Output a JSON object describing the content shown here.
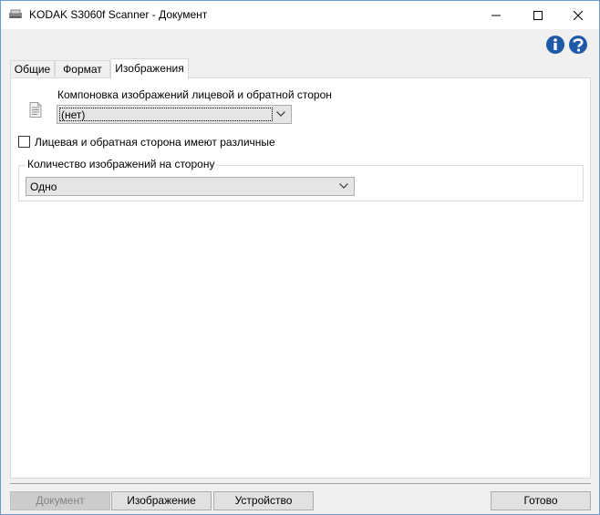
{
  "window": {
    "title": "KODAK S3060f Scanner - Документ",
    "app_icon": "scanner-icon",
    "controls": [
      "minimize-icon",
      "maximize-icon",
      "close-icon"
    ]
  },
  "help": {
    "icons": [
      "info-icon",
      "help-icon"
    ]
  },
  "tabs": [
    {
      "label": "Общие",
      "active": false
    },
    {
      "label": "Формат",
      "active": false
    },
    {
      "label": "Изображения",
      "active": true
    }
  ],
  "images_tab": {
    "layout_label": "Компоновка изображений лицевой и обратной сторон",
    "layout_value": "(нет)",
    "different_sides_label": "Лицевая и обратная сторона имеют различные",
    "different_sides_checked": false,
    "count_group_title": "Количество изображений на сторону",
    "count_value": "Одно"
  },
  "buttons": {
    "document": "Документ",
    "image": "Изображение",
    "device": "Устройство",
    "done": "Готово"
  },
  "colors": {
    "info_blue": "#1e5aa8",
    "window_border": "#6b9bd1"
  }
}
